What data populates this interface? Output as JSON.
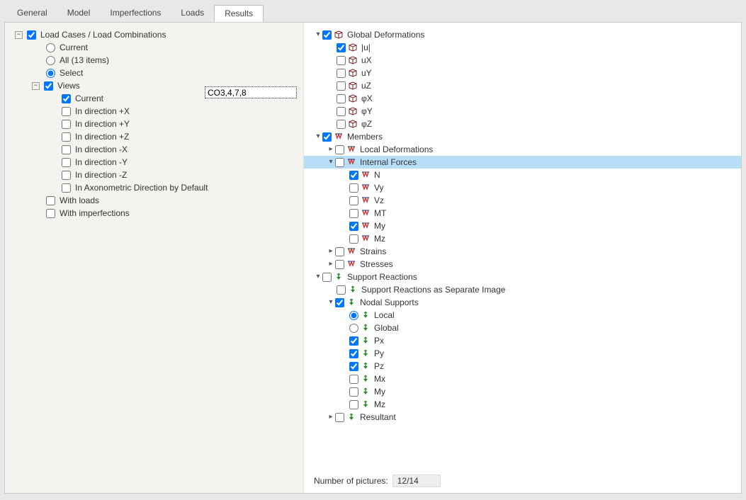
{
  "tabs": [
    "General",
    "Model",
    "Imperfections",
    "Loads",
    "Results"
  ],
  "active_tab": 4,
  "left": {
    "load_cases": "Load Cases / Load Combinations",
    "current": "Current",
    "all": "All (13 items)",
    "select": "Select",
    "co_value": "CO3,4,7,8",
    "views": "Views",
    "v_current": "Current",
    "dir_px": "In direction +X",
    "dir_py": "In direction +Y",
    "dir_pz": "In direction +Z",
    "dir_mx": "In direction -X",
    "dir_my": "In direction -Y",
    "dir_mz": "In direction -Z",
    "axo": "In Axonometric Direction by Default",
    "with_loads": "With loads",
    "with_imps": "With imperfections"
  },
  "right": {
    "global_def": "Global Deformations",
    "u": "|u|",
    "ux": "uX",
    "uy": "uY",
    "uz": "uZ",
    "phx": "φX",
    "phy": "φY",
    "phz": "φZ",
    "members": "Members",
    "local_def": "Local Deformations",
    "internal_forces": "Internal Forces",
    "n": "N",
    "vy": "Vy",
    "vz": "Vz",
    "mt": "MT",
    "my": "My",
    "mz": "Mz",
    "strains": "Strains",
    "stresses": "Stresses",
    "support_reactions": "Support Reactions",
    "sr_sep": "Support Reactions as Separate Image",
    "nodal_supports": "Nodal Supports",
    "local": "Local",
    "global": "Global",
    "px": "Px",
    "py": "Py",
    "pz": "Pz",
    "mx": "Mx",
    "r_my": "My",
    "r_mz": "Mz",
    "resultant": "Resultant"
  },
  "footer": {
    "label": "Number of pictures:",
    "value": "12/14"
  }
}
